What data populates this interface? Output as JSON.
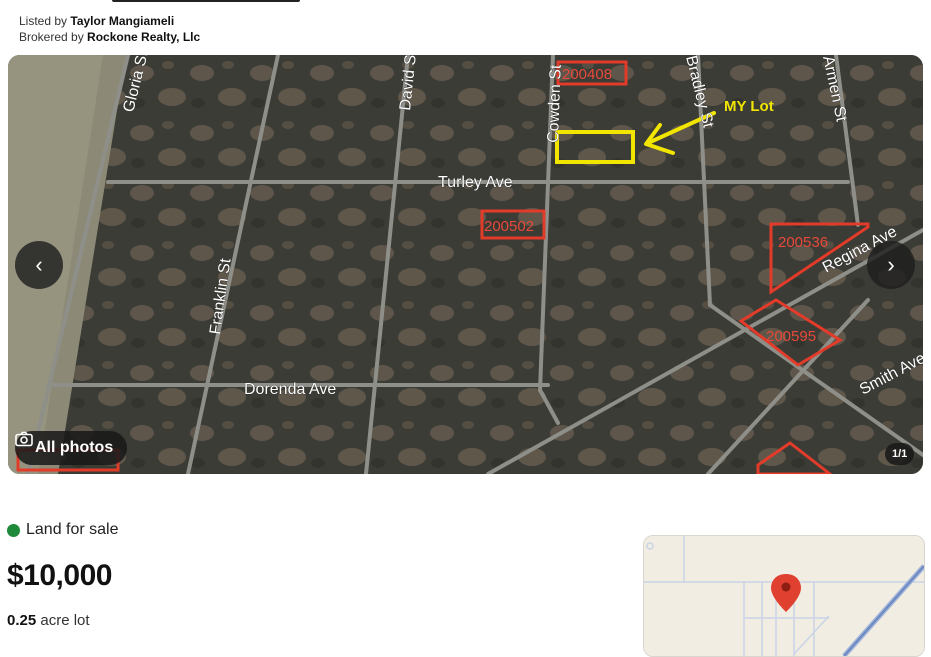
{
  "listing": {
    "listed_by_label": "Listed by",
    "listed_by_name": "Taylor Mangiameli",
    "brokered_by_label": "Brokered by",
    "brokered_by_name": "Rockone Realty, Llc"
  },
  "photo": {
    "streets": {
      "gloria": "Gloria St",
      "david": "David St",
      "cowden": "Cowden St",
      "bradley": "Bradley St",
      "armen": "Armen St",
      "turley": "Turley Ave",
      "franklin": "Franklin St",
      "dorenda": "Dorenda Ave",
      "regina": "Regina Ave",
      "smith": "Smith Ave"
    },
    "parcels": {
      "p1": "200408",
      "p2": "200502",
      "p3": "200536",
      "p4": "200595"
    },
    "annotation": "MY Lot",
    "all_photos_label": "All photos",
    "counter": "1/1",
    "prev_icon": "chevron-left-icon",
    "next_icon": "chevron-right-icon",
    "annotation_color": "#f2e600",
    "parcel_color": "#e23b2a"
  },
  "status": {
    "label": "Land for sale",
    "color": "#1f8a3a"
  },
  "price": "$10,000",
  "lot": {
    "value": "0.25",
    "unit": "acre lot"
  }
}
